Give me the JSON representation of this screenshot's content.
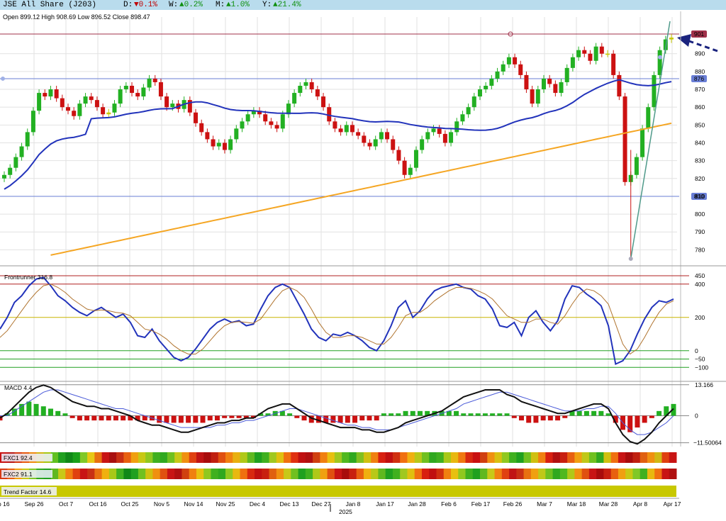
{
  "header": {
    "title": "JSE All Share (J203)",
    "d_label": "D:",
    "d_value": "▼0.1%",
    "w_label": "W:",
    "w_value": "▲0.2%",
    "m_label": "M:",
    "m_value": "▲1.0%",
    "y_label": "Y:",
    "y_value": "▲21.4%"
  },
  "ohlc_line": "Open 899.12  High 908.69  Low 896.52  Close 898.47",
  "colors": {
    "bull": "#22b022",
    "bear": "#cc1111",
    "neutral": "#c8c800",
    "ma_short": "#2233bb",
    "ma_long": "#f5a623",
    "indicator_main": "#2233bb",
    "indicator_signal": "#b0742f"
  },
  "chart_data": [
    {
      "type": "candlestick",
      "title": "JSE All Share (J203)",
      "price_axis": {
        "ticks": [
          780,
          790,
          800,
          810,
          820,
          830,
          840,
          850,
          860,
          870,
          880,
          890
        ],
        "ylim": [
          773,
          905
        ]
      },
      "x_labels": [
        "Sep 26",
        "Oct 7",
        "Oct 16",
        "Oct 25",
        "Nov 5",
        "Nov 14",
        "Nov 25",
        "Dec 4",
        "Dec 13",
        "Dec 27",
        "Jan 8",
        "Jan 17",
        "Jan 28",
        "Feb 6",
        "Feb 17",
        "Feb 26",
        "Mar 7",
        "Mar 18",
        "Mar 28",
        "Apr 8",
        "Apr 17"
      ],
      "x_partial_label": "p 16",
      "year_label": "2025",
      "levels": [
        {
          "value": 876,
          "label": "876",
          "color": "#6a7fd6"
        },
        {
          "value": 810,
          "label": "810",
          "color": "#6a7fd6"
        },
        {
          "value": 901,
          "label": "901",
          "color": "#a0304a"
        }
      ],
      "grid": true
    },
    {
      "type": "line",
      "title": "Frontrunner 316.8",
      "axis_ticks": [
        "450",
        "400",
        "200",
        "0",
        "−50",
        "−100"
      ],
      "ylim": [
        -150,
        480
      ],
      "series": [
        {
          "values": [
            130,
            200,
            290,
            330,
            390,
            430,
            440,
            390,
            330,
            300,
            260,
            230,
            210,
            240,
            260,
            230,
            200,
            220,
            170,
            90,
            80,
            130,
            60,
            10,
            -40,
            -60,
            -40,
            10,
            70,
            130,
            170,
            190,
            170,
            180,
            150,
            160,
            250,
            330,
            380,
            400,
            380,
            300,
            220,
            130,
            80,
            60,
            100,
            90,
            110,
            90,
            60,
            20,
            0,
            60,
            150,
            260,
            300,
            200,
            240,
            310,
            360,
            380,
            390,
            400,
            380,
            370,
            330,
            310,
            250,
            150,
            140,
            170,
            90,
            200,
            240,
            170,
            120,
            180,
            310,
            390,
            380,
            340,
            310,
            270,
            150,
            -80,
            -60,
            0,
            100,
            190,
            260,
            300,
            290,
            310
          ]
        },
        {
          "values": [
            80,
            120,
            180,
            240,
            300,
            350,
            390,
            400,
            380,
            350,
            310,
            280,
            250,
            240,
            245,
            240,
            230,
            225,
            210,
            170,
            130,
            120,
            100,
            70,
            30,
            0,
            -20,
            -20,
            10,
            60,
            110,
            150,
            170,
            175,
            170,
            165,
            190,
            250,
            310,
            360,
            380,
            360,
            320,
            250,
            170,
            110,
            80,
            80,
            90,
            90,
            80,
            60,
            40,
            40,
            80,
            140,
            210,
            230,
            230,
            260,
            300,
            330,
            360,
            380,
            380,
            375,
            360,
            340,
            310,
            260,
            210,
            190,
            170,
            170,
            190,
            190,
            170,
            160,
            210,
            280,
            340,
            370,
            360,
            330,
            280,
            160,
            40,
            -20,
            10,
            80,
            160,
            230,
            280,
            300
          ]
        }
      ]
    },
    {
      "type": "bar",
      "title": "MACD 4.4",
      "axis_ticks": [
        "13.166",
        "0",
        "−11.50064"
      ],
      "ylim": [
        -12.5,
        14
      ],
      "histogram": [
        -2,
        1,
        3,
        5,
        6,
        5,
        4,
        3,
        2,
        1,
        -1,
        -2,
        -2,
        -2,
        -2,
        -2,
        -2,
        -2,
        -2,
        -2,
        -2,
        -2,
        -3,
        -3,
        -3,
        -3,
        -3,
        -3,
        -3,
        -2,
        -2,
        -1,
        -1,
        -1,
        -1,
        -1,
        1,
        1,
        2,
        2,
        1,
        -1,
        -2,
        -3,
        -3,
        -3,
        -3,
        -3,
        -3,
        -3,
        -2,
        -2,
        -2,
        1,
        1,
        1,
        2,
        2,
        2,
        2,
        2,
        2,
        2,
        2,
        1,
        1,
        1,
        1,
        1,
        1,
        1,
        -1,
        -2,
        -3,
        -3,
        -2,
        -2,
        -2,
        -1,
        2,
        2,
        2,
        2,
        2,
        1,
        -3,
        -6,
        -7,
        -5,
        -3,
        -1,
        2,
        4,
        5
      ],
      "macd_line": [
        -1,
        1,
        4,
        7,
        10,
        12,
        13,
        12,
        10,
        8,
        6,
        5,
        4,
        4,
        3,
        3,
        2,
        1,
        0,
        -2,
        -3,
        -4,
        -4,
        -5,
        -6,
        -7,
        -7,
        -6,
        -5,
        -4,
        -3,
        -3,
        -2,
        -2,
        -1,
        -1,
        1,
        3,
        4,
        5,
        5,
        3,
        1,
        -1,
        -2,
        -3,
        -4,
        -5,
        -5,
        -5,
        -6,
        -6,
        -7,
        -7,
        -6,
        -5,
        -3,
        -2,
        -1,
        0,
        1,
        2,
        4,
        6,
        8,
        9,
        10,
        11,
        11,
        11,
        9,
        8,
        6,
        5,
        4,
        3,
        2,
        1,
        1,
        2,
        3,
        4,
        5,
        5,
        3,
        -3,
        -8,
        -11,
        -12,
        -10,
        -7,
        -3,
        0,
        3
      ],
      "signal_line": [
        0,
        0,
        2,
        4,
        6,
        8,
        10,
        11,
        11,
        10,
        9,
        8,
        7,
        6,
        5,
        4,
        3,
        3,
        2,
        1,
        0,
        -1,
        -2,
        -3,
        -4,
        -5,
        -5,
        -5,
        -5,
        -5,
        -4,
        -4,
        -3,
        -3,
        -2,
        -2,
        -1,
        0,
        1,
        2,
        3,
        3,
        2,
        1,
        0,
        -1,
        -2,
        -3,
        -4,
        -4,
        -5,
        -5,
        -6,
        -6,
        -6,
        -5,
        -4,
        -3,
        -2,
        -1,
        0,
        1,
        2,
        3,
        5,
        6,
        7,
        8,
        9,
        10,
        10,
        9,
        8,
        7,
        6,
        5,
        4,
        3,
        2,
        2,
        2,
        3,
        3,
        4,
        4,
        1,
        -3,
        -6,
        -8,
        -8,
        -7,
        -5,
        -3,
        0
      ]
    },
    {
      "type": "heatmap",
      "title": "FXC1 92.4",
      "colors": [
        "#c81414",
        "#b81818",
        "#d83a14",
        "#e85a10",
        "#f08c10",
        "#d2b414",
        "#a8c814",
        "#60c020",
        "#20a020",
        "#108818",
        "#1aa01a",
        "#80c828",
        "#e8c814",
        "#e87010",
        "#c81414",
        "#a81010",
        "#c83014",
        "#e86010",
        "#f0a010",
        "#c8c814",
        "#90c820",
        "#40b020",
        "#30a820",
        "#70c020",
        "#c8c818",
        "#f09010",
        "#e04010",
        "#c01414",
        "#a80c0c",
        "#c02010",
        "#e05010",
        "#f08010",
        "#e8b010",
        "#b0c818",
        "#60b820",
        "#20a020",
        "#40b020",
        "#a0c820",
        "#e0c010",
        "#f07010",
        "#e03010",
        "#c01010",
        "#b01010",
        "#d04010",
        "#f08010",
        "#e8c010",
        "#a0c820",
        "#50b820",
        "#30a820",
        "#80c020",
        "#d0c010",
        "#f08010",
        "#d82010",
        "#c01010",
        "#d03010",
        "#f07010",
        "#f0b010",
        "#b8c818",
        "#70c020",
        "#30a820",
        "#40b020",
        "#a8c818",
        "#e8b810",
        "#f07810",
        "#d82810",
        "#c81010",
        "#d04010",
        "#f09010",
        "#d8c010",
        "#90c820",
        "#40b020",
        "#20a020",
        "#70c020",
        "#d0c010",
        "#f08010",
        "#d82010",
        "#b01010",
        "#c82010",
        "#e86010",
        "#f0a010",
        "#c0c818",
        "#70c020",
        "#30a820",
        "#d0c010",
        "#f07010",
        "#c81414",
        "#a80c0c",
        "#c02010",
        "#e06010",
        "#f09010",
        "#d0b814",
        "#e04010",
        "#c81414"
      ]
    },
    {
      "type": "heatmap",
      "title": "FXC2 91.1",
      "colors": [
        "#d83a14",
        "#e86010",
        "#f0a010",
        "#c8c814",
        "#80c828",
        "#30a820",
        "#20a020",
        "#60b820",
        "#c8c818",
        "#f08010",
        "#e04010",
        "#c81414",
        "#c83014",
        "#e87010",
        "#f0b010",
        "#a8c818",
        "#40b020",
        "#108818",
        "#20a020",
        "#70c020",
        "#d0c010",
        "#f09010",
        "#e05010",
        "#c81414",
        "#b01010",
        "#d04010",
        "#f08010",
        "#e8c010",
        "#90c820",
        "#40b020",
        "#30a820",
        "#90c820",
        "#e8b810",
        "#f07010",
        "#d82810",
        "#c01010",
        "#c82010",
        "#e06010",
        "#f09010",
        "#c8c818",
        "#70c020",
        "#20a020",
        "#40b020",
        "#b0c818",
        "#f0a010",
        "#e05010",
        "#c81414",
        "#a80c0c",
        "#c82010",
        "#e86010",
        "#f0b010",
        "#b8c818",
        "#60b820",
        "#20a020",
        "#40b020",
        "#a0c820",
        "#e0c010",
        "#f07010",
        "#d82010",
        "#c01010",
        "#d03010",
        "#f08010",
        "#e8c010",
        "#90c820",
        "#40b020",
        "#20a020",
        "#60b820",
        "#c8c818",
        "#f08010",
        "#e04010",
        "#c01414",
        "#c83014",
        "#e87010",
        "#f0a010",
        "#c0c818",
        "#70c020",
        "#30a820",
        "#50b820",
        "#b0c818",
        "#f09010",
        "#e05010",
        "#c81414",
        "#a80c0c",
        "#c82010",
        "#e86010",
        "#f0a010",
        "#c8c814",
        "#80c828",
        "#40b020",
        "#e8b810",
        "#f07010",
        "#c81414",
        "#b01010"
      ]
    },
    {
      "type": "bar",
      "title": "Trend Factor 14.6",
      "fill_color": "#c8c800"
    }
  ]
}
